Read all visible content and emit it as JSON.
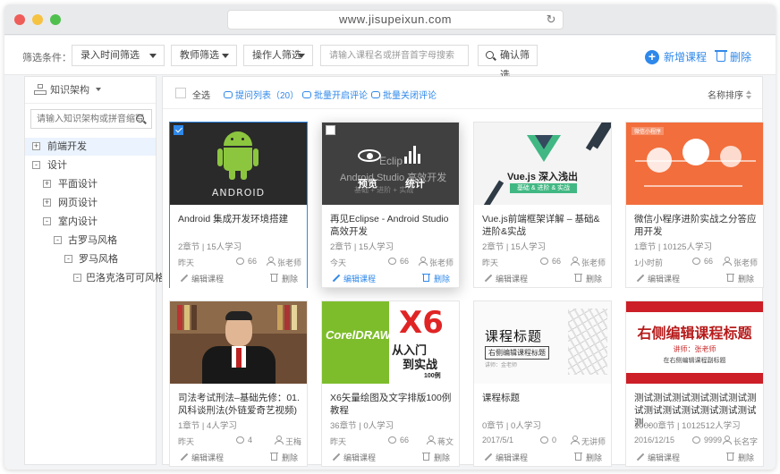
{
  "browser": {
    "url": "www.jisupeixun.com"
  },
  "filters": {
    "label": "筛选条件：",
    "entry_time": "录入时间筛选",
    "teacher": "教师筛选",
    "operator": "操作人筛选",
    "search_placeholder": "请输入课程名或拼音首字母搜索",
    "confirm": "确认筛选",
    "add_course": "新增课程",
    "delete": "删除"
  },
  "sidebar": {
    "header": "知识架构",
    "search_placeholder": "请输入知识架构或拼音缩写",
    "tree": [
      {
        "label": "前端开发",
        "toggle": "+"
      },
      {
        "label": "设计",
        "toggle": "-"
      },
      {
        "label": "平面设计",
        "toggle": "+"
      },
      {
        "label": "网页设计",
        "toggle": "+"
      },
      {
        "label": "室内设计",
        "toggle": "-"
      },
      {
        "label": "古罗马风格",
        "toggle": "-"
      },
      {
        "label": "罗马风格",
        "toggle": "-"
      },
      {
        "label": "巴洛克洛可可风格",
        "toggle": "-"
      }
    ]
  },
  "toolbar": {
    "select_all": "全选",
    "question_list": "提问列表（20）",
    "batch_open": "批量开启评论",
    "batch_close": "批量关闭评论",
    "sort": "名称排序"
  },
  "card_labels": {
    "edit": "编辑课程",
    "delete": "删除"
  },
  "thumb_text": {
    "android": "ANDROID",
    "eclipse_bg1": "Eclip",
    "eclipse_bg2": "Android Studio 高效开发",
    "eclipse_bg3": "基础 + 进阶 + 实战",
    "eclipse_preview": "预览",
    "eclipse_stats": "统计",
    "vue_title": "Vue.js 深入浅出",
    "vue_sub": "基础 & 进阶 & 实战",
    "wx_tag": "微信小程序",
    "cdr_brand": "CorelDRAW",
    "cdr_x6": "X6",
    "cdr_t1": "从入门",
    "cdr_t2": "到实战",
    "cdr_t3": "100例",
    "plain_big": "课程标题",
    "plain_small": "右侧编辑课程标题",
    "plain_tiny": "讲师：金老师",
    "red_big": "右侧编辑课程标题",
    "red_s1": "讲师：张老师",
    "red_s2": "在右侧编辑课程副标题"
  },
  "cards": [
    {
      "title": "Android 集成开发环境搭建",
      "meta": "2章节 | 15人学习",
      "date": "昨天",
      "comments": "66",
      "teacher": "张老师"
    },
    {
      "title": "再见Eclipse - Android Studio 高效开发",
      "meta": "2章节 | 15人学习",
      "date": "今天",
      "comments": "66",
      "teacher": "张老师"
    },
    {
      "title": "Vue.js前端框架详解 – 基础&进阶&实战",
      "meta": "2章节 | 15人学习",
      "date": "昨天",
      "comments": "66",
      "teacher": "张老师"
    },
    {
      "title": "微信小程序进阶实战之分答应用开发",
      "meta": "1章节 | 10125人学习",
      "date": "1小时前",
      "comments": "66",
      "teacher": "张老师"
    },
    {
      "title": "司法考试刑法–基础先修：01.风科谈刑法(外链爱奇艺视频)",
      "meta": "1章节 | 4人学习",
      "date": "昨天",
      "comments": "4",
      "teacher": "王梅"
    },
    {
      "title": "X6矢量绘图及文字排版100例教程",
      "meta": "36章节 | 0人学习",
      "date": "昨天",
      "comments": "66",
      "teacher": "蒋文"
    },
    {
      "title": "课程标题",
      "meta": "0章节 | 0人学习",
      "date": "2017/5/1",
      "comments": "0",
      "teacher": "无讲师"
    },
    {
      "title": "测试测试测试测试测试测试测试测试测试测试测试测试测试测...",
      "meta": "10000章节 | 1012512人学习",
      "date": "2016/12/15",
      "comments": "9999",
      "teacher": "长名字"
    }
  ],
  "colors": {
    "accent": "#2f88ea",
    "android_green": "#8cc63f",
    "vue_green": "#41b883",
    "wx_orange": "#f26e3c",
    "cdr_green": "#7dbd2c",
    "red": "#cc1f27"
  }
}
